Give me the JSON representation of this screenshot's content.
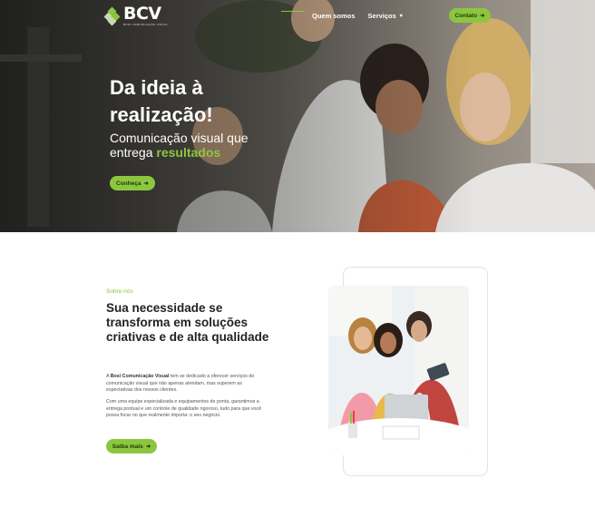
{
  "header": {
    "logo": {
      "text": "BCV",
      "tagline": "BOSI COMUNICAÇÃO VISUAL"
    },
    "nav": [
      {
        "label": "Quem somos",
        "icon": ""
      },
      {
        "label": "Serviços",
        "icon": "chevron-down-icon"
      }
    ],
    "contact_label": "Contato",
    "contact_icon": "arrow-right-icon"
  },
  "hero": {
    "title_line1": "Da ideia à",
    "title_line2": "realização!",
    "subtitle_line1": "Comunicação visual que",
    "subtitle_prefix": "entrega ",
    "subtitle_highlight": "resultados",
    "button_label": "Conheça"
  },
  "about": {
    "eyebrow": "Sobre nós",
    "title": "Sua necessidade se transforma em soluções criativas e de alta qualidade",
    "p1_prefix": "A ",
    "p1_brand": "Bosi Comunicação Visual",
    "p1_rest": " tem se dedicado a oferecer serviços de comunicação visual que não apenas atendam, mas superem as expectativas dos nossos clientes.",
    "p2": "Com uma equipe especializada e equipamentos de ponta, garantimos a entrega pontual e um controle de qualidade rigoroso, tudo para que você possa focar no que realmente importa: o seu negócio.",
    "button_label": "Saiba mais"
  },
  "colors": {
    "accent": "#8cc63f",
    "accent_text": "#1f3a05",
    "text_dark": "#222222",
    "text_body": "#555555"
  }
}
